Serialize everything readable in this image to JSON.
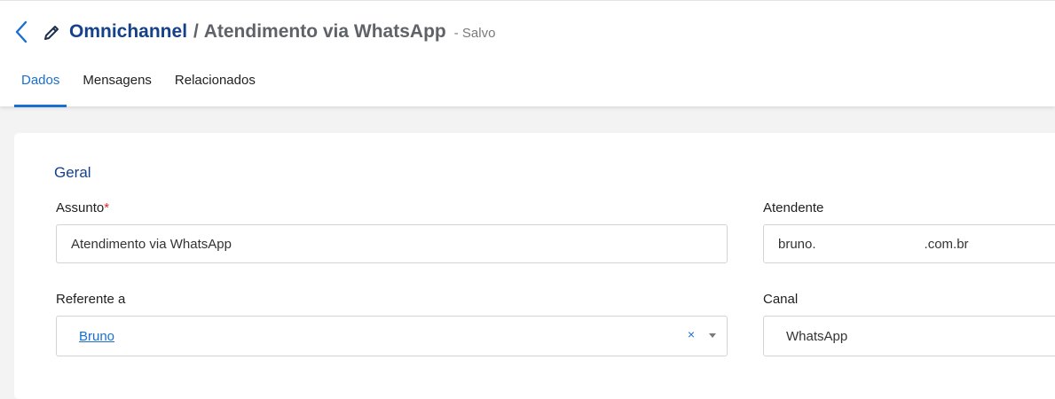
{
  "header": {
    "back_icon": "chevron-left-icon",
    "edit_icon": "pencil-icon",
    "breadcrumb_root": "Omnichannel",
    "breadcrumb_separator": "/",
    "title": "Atendimento via WhatsApp",
    "status": "- Salvo"
  },
  "tabs": [
    {
      "label": "Dados",
      "active": true
    },
    {
      "label": "Mensagens",
      "active": false
    },
    {
      "label": "Relacionados",
      "active": false
    }
  ],
  "form": {
    "section_title": "Geral",
    "assunto": {
      "label": "Assunto",
      "required_mark": "*",
      "value": "Atendimento via WhatsApp"
    },
    "atendente": {
      "label": "Atendente",
      "value_prefix": "bruno.",
      "value_suffix": ".com.br"
    },
    "referente": {
      "label": "Referente a",
      "value": "Bruno",
      "clear_icon": "close-icon",
      "clear_glyph": "×",
      "dropdown_icon": "caret-down-icon"
    },
    "canal": {
      "label": "Canal",
      "value": "WhatsApp"
    }
  },
  "colors": {
    "accent": "#1a6fd0",
    "title_blue": "#15408a",
    "required": "#e02424",
    "page_bg": "#f3f3f4"
  }
}
